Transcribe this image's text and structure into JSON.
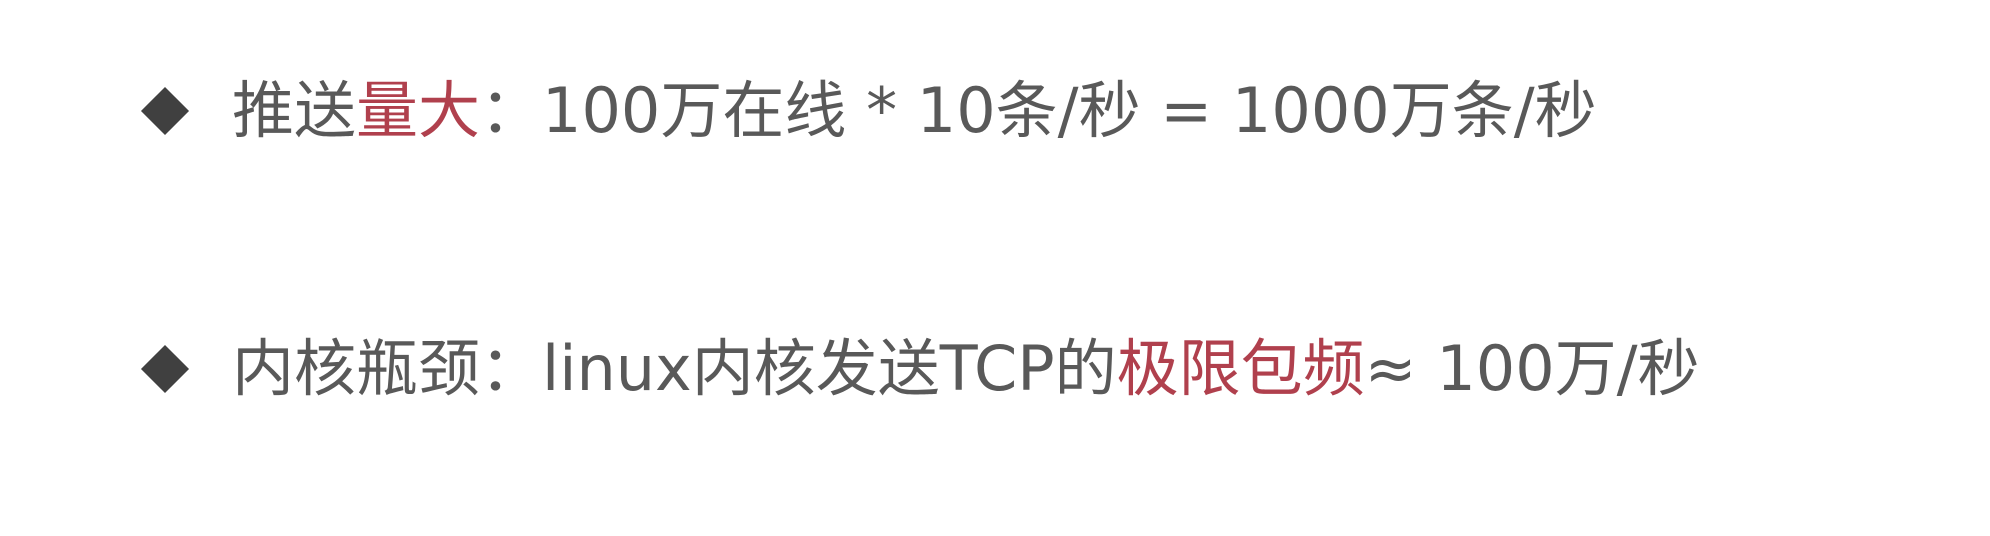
{
  "colors": {
    "text": "#595959",
    "bullet": "#404040",
    "highlight": "#b0404d",
    "background": "#ffffff"
  },
  "bullets": [
    {
      "icon": "diamond-bullet-icon",
      "lead": "推送",
      "highlight": "量大",
      "rest": "：100万在线 * 10条/秒 = 1000万条/秒"
    },
    {
      "icon": "diamond-bullet-icon",
      "lead": "内核瓶颈：linux内核发送TCP的",
      "highlight": "极限包频",
      "rest": " ≈ 100万/秒"
    }
  ]
}
